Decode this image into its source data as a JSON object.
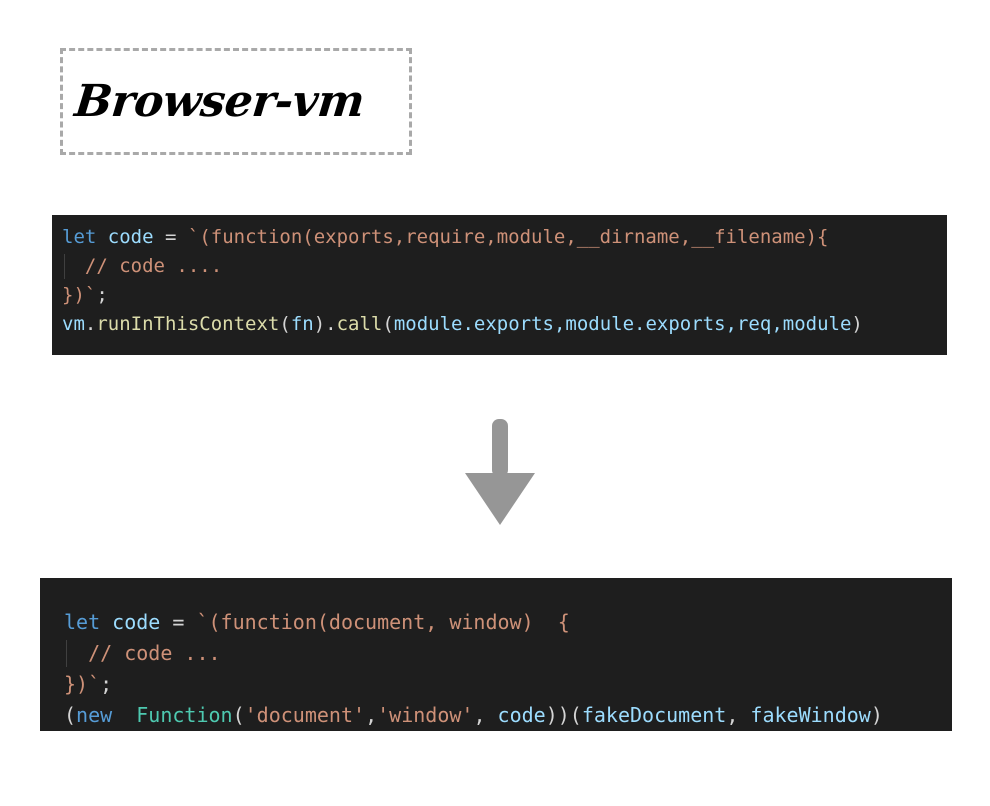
{
  "title_card": {
    "label": "Browser-vm",
    "border_color": "#a9a9a9",
    "border_style": "dashed"
  },
  "theme": {
    "code_background": "#1e1e1e",
    "default_text": "#d4d4d4",
    "keyword": "#569cd6",
    "variable": "#9cdcfe",
    "string": "#ce9178",
    "comment": "#ce9178",
    "function_name": "#dcdcaa",
    "class_name": "#4ec9b0",
    "arrow": "#969696",
    "page_background": "#ffffff"
  },
  "code_blocks": [
    {
      "id": "nodejs-vm-snippet",
      "language": "javascript",
      "lines": [
        {
          "indented": false,
          "tokens": [
            {
              "text": "let",
              "type": "kw"
            },
            {
              "text": " ",
              "type": "op"
            },
            {
              "text": "code",
              "type": "var"
            },
            {
              "text": " = ",
              "type": "op"
            },
            {
              "text": "`(function(exports,require,module,__dirname,__filename){",
              "type": "str"
            }
          ]
        },
        {
          "indented": true,
          "tokens": [
            {
              "text": "  // code ....",
              "type": "comment"
            }
          ]
        },
        {
          "indented": false,
          "tokens": [
            {
              "text": "})`",
              "type": "punct"
            },
            {
              "text": ";",
              "type": "op"
            }
          ]
        },
        {
          "indented": false,
          "tokens": [
            {
              "text": "vm",
              "type": "var"
            },
            {
              "text": ".",
              "type": "op"
            },
            {
              "text": "runInThisContext",
              "type": "fn"
            },
            {
              "text": "(",
              "type": "op"
            },
            {
              "text": "fn",
              "type": "var"
            },
            {
              "text": ").",
              "type": "op"
            },
            {
              "text": "call",
              "type": "fn"
            },
            {
              "text": "(",
              "type": "op"
            },
            {
              "text": "module.exports,module.exports,req,module",
              "type": "var"
            },
            {
              "text": ")",
              "type": "op"
            }
          ]
        }
      ]
    },
    {
      "id": "browser-function-snippet",
      "language": "javascript",
      "lines": [
        {
          "indented": false,
          "tokens": [
            {
              "text": "let",
              "type": "kw"
            },
            {
              "text": " ",
              "type": "op"
            },
            {
              "text": "code",
              "type": "var"
            },
            {
              "text": " = ",
              "type": "op"
            },
            {
              "text": "`(function(document, window)  {",
              "type": "str"
            }
          ]
        },
        {
          "indented": true,
          "tokens": [
            {
              "text": "  // code ...",
              "type": "comment"
            }
          ]
        },
        {
          "indented": false,
          "tokens": [
            {
              "text": "})`",
              "type": "punct"
            },
            {
              "text": ";",
              "type": "op"
            }
          ]
        },
        {
          "indented": false,
          "tokens": [
            {
              "text": "(",
              "type": "op"
            },
            {
              "text": "new",
              "type": "kw"
            },
            {
              "text": "  ",
              "type": "op"
            },
            {
              "text": "Function",
              "type": "class"
            },
            {
              "text": "(",
              "type": "op"
            },
            {
              "text": "'document'",
              "type": "str"
            },
            {
              "text": ",",
              "type": "op"
            },
            {
              "text": "'window'",
              "type": "str"
            },
            {
              "text": ", ",
              "type": "op"
            },
            {
              "text": "code",
              "type": "var"
            },
            {
              "text": "))(",
              "type": "op"
            },
            {
              "text": "fakeDocument",
              "type": "var"
            },
            {
              "text": ", ",
              "type": "op"
            },
            {
              "text": "fakeWindow",
              "type": "var"
            },
            {
              "text": ")",
              "type": "op"
            }
          ]
        }
      ]
    }
  ],
  "arrow": {
    "name": "down-arrow",
    "direction": "down",
    "color": "#969696"
  }
}
